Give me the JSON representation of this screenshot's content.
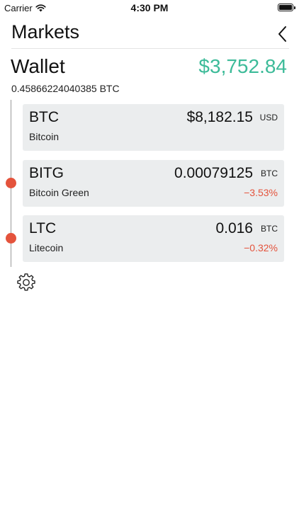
{
  "status_bar": {
    "carrier": "Carrier",
    "time": "4:30 PM",
    "icons": [
      "wifi-icon",
      "battery-icon"
    ]
  },
  "nav": {
    "title": "Markets",
    "back_icon": "chevron-left-icon"
  },
  "wallet": {
    "label": "Wallet",
    "total_usd": "$3,752.84",
    "total_btc": "0.45866224040385 BTC"
  },
  "markets": [
    {
      "symbol": "BTC",
      "name": "Bitcoin",
      "price": "$8,182.15",
      "unit": "USD",
      "change": ""
    },
    {
      "symbol": "BITG",
      "name": "Bitcoin Green",
      "price": "0.00079125",
      "unit": "BTC",
      "change": "−3.53%"
    },
    {
      "symbol": "LTC",
      "name": "Litecoin",
      "price": "0.016",
      "unit": "BTC",
      "change": "−0.32%"
    }
  ],
  "settings_icon": "gear-icon",
  "colors": {
    "accent_green": "#3dbb99",
    "negative_red": "#e4533c",
    "card_background": "#ebedee"
  }
}
